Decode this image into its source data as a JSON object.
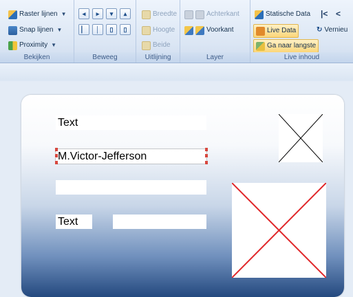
{
  "ribbon": {
    "bekijken": {
      "label": "Bekijken",
      "items": [
        "Raster lijnen",
        "Snap lijnen",
        "Proximity"
      ]
    },
    "beweeg": {
      "label": "Beweeg"
    },
    "uitlijning": {
      "label": "Uitlijning",
      "items": [
        "Breedte",
        "Hoogte",
        "Beide"
      ]
    },
    "layer": {
      "label": "Layer",
      "items": [
        "Achterkant",
        "Voorkant"
      ]
    },
    "live_inhoud": {
      "label": "Live inhoud",
      "items": [
        "Statische Data",
        "Live Data",
        "Ga naar langste",
        "Vernieu"
      ]
    }
  },
  "card": {
    "fields": [
      {
        "value": "Text"
      },
      {
        "value": "M.Victor-Jefferson"
      },
      {
        "value": ""
      },
      {
        "value": "Text"
      },
      {
        "value": ""
      }
    ]
  },
  "colors": {
    "accent": "#2d6fb8",
    "handle": "#d7483f",
    "image_cross_red": "#e0272a"
  }
}
